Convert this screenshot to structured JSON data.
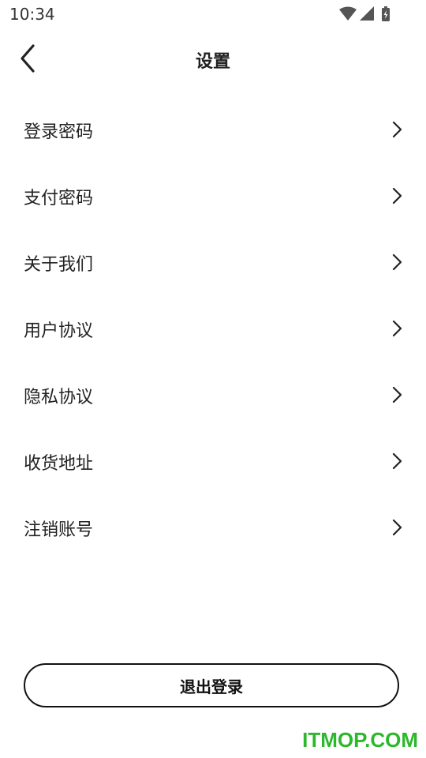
{
  "status_bar": {
    "time": "10:34"
  },
  "header": {
    "title": "设置"
  },
  "menu": {
    "items": [
      {
        "label": "登录密码"
      },
      {
        "label": "支付密码"
      },
      {
        "label": "关于我们"
      },
      {
        "label": "用户协议"
      },
      {
        "label": "隐私协议"
      },
      {
        "label": "收货地址"
      },
      {
        "label": "注销账号"
      }
    ]
  },
  "footer": {
    "logout_label": "退出登录"
  },
  "watermark": {
    "text": "ITMOP.COM"
  },
  "colors": {
    "watermark": "#2cb82c",
    "text": "#222222",
    "background": "#ffffff"
  }
}
